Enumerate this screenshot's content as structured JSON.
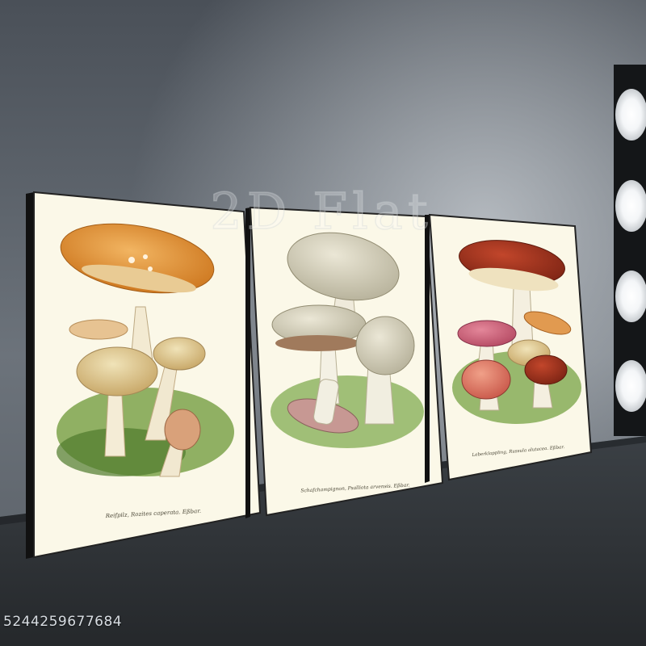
{
  "watermark": "2D Flat",
  "stock_id": "5244259677684",
  "panels": [
    {
      "caption": "Reifpilz, Rozites caperata. Eßbar."
    },
    {
      "caption": "Schafchampignon, Psalliota arvensis. Eßbar."
    },
    {
      "caption": "Leberklappling, Russula alutacea. Eßbar."
    }
  ],
  "colors": {
    "wall": "#596068",
    "floor": "#2e3236",
    "paper": "#fbf8e8",
    "canvas_edge": "#1c1c1c",
    "light": "#ffffff"
  }
}
